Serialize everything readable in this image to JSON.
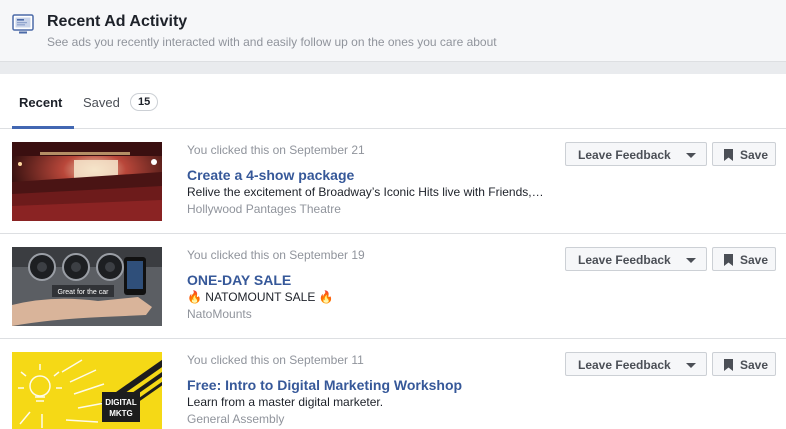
{
  "header": {
    "title": "Recent Ad Activity",
    "subtitle": "See ads you recently interacted with and easily follow up on the ones you care about",
    "icon": "monitor-icon"
  },
  "tabs": {
    "recent_label": "Recent",
    "saved_label": "Saved",
    "saved_count": "15"
  },
  "buttons": {
    "feedback_label": "Leave Feedback",
    "save_label": "Save"
  },
  "ads": [
    {
      "clicked": "You clicked this on September 21",
      "title": "Create a 4-show package",
      "description": "Relive the excitement of Broadway’s Iconic Hits live with Friends,…",
      "advertiser": "Hollywood Pantages Theatre",
      "image": "theatre-photo"
    },
    {
      "clicked": "You clicked this on September 19",
      "title": "ONE-DAY SALE",
      "description_prefix": "🔥",
      "description": "NATOMOUNT SALE",
      "description_suffix": "🔥",
      "advertiser": "NatoMounts",
      "image": "car-phone-mount-photo",
      "image_caption": "Great for the car"
    },
    {
      "clicked": "You clicked this on September 11",
      "title": "Free: Intro to Digital Marketing Workshop",
      "description": "Learn from a master digital marketer.",
      "advertiser": "General Assembly",
      "image": "digital-mktg-graphic",
      "image_caption_line1": "DIGITAL",
      "image_caption_line2": "MKTG"
    }
  ],
  "colors": {
    "link": "#365899",
    "accent": "#4267b2",
    "muted": "#90949c",
    "yellow": "#f5d916"
  }
}
